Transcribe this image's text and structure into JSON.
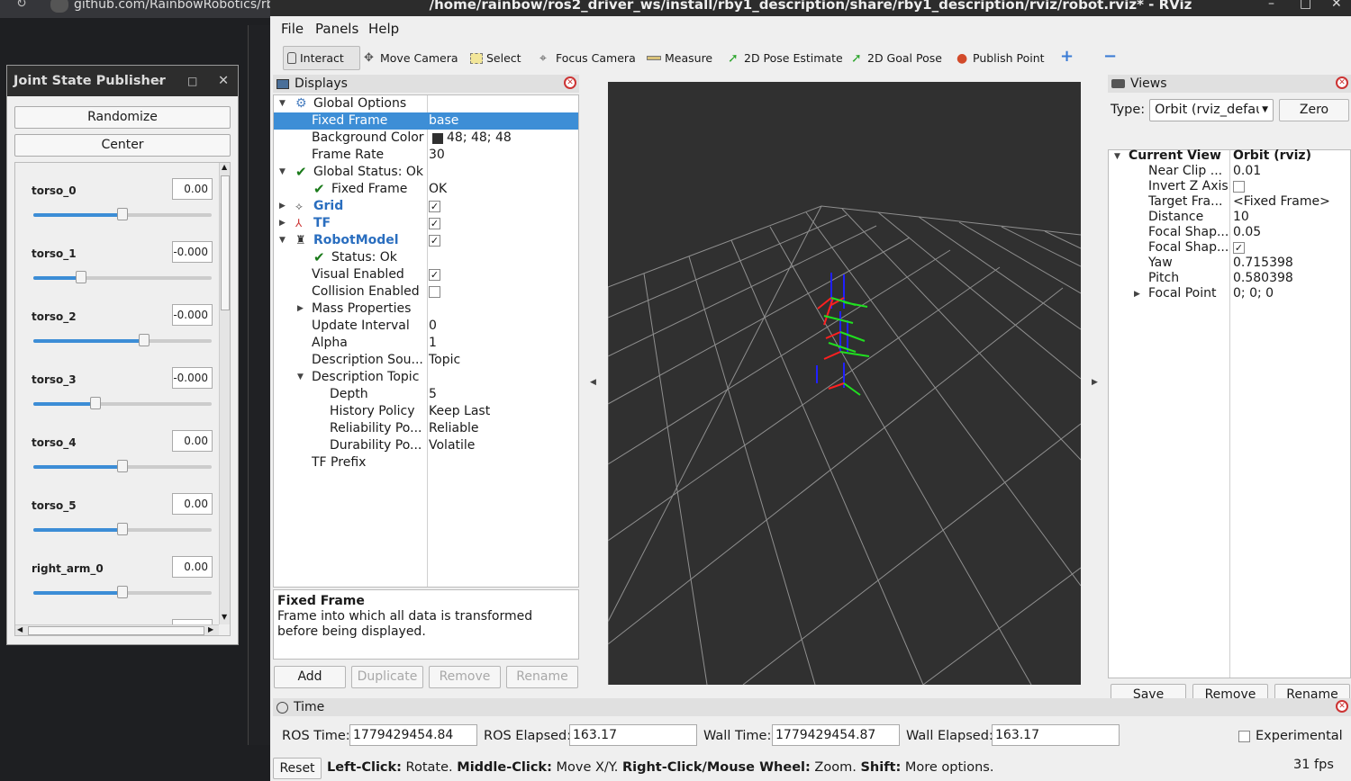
{
  "browser": {
    "url": "github.com/RainbowRobotics/rby"
  },
  "window": {
    "title": "/home/rainbow/ros2_driver_ws/install/rby1_description/share/rby1_description/rviz/robot.rviz* - RViz",
    "min": "–",
    "max": "□",
    "close": "✕"
  },
  "menu": [
    "File",
    "Panels",
    "Help"
  ],
  "toolbar": {
    "interact": "Interact",
    "move_camera": "Move Camera",
    "select": "Select",
    "focus_camera": "Focus Camera",
    "measure": "Measure",
    "pose_estimate": "2D Pose Estimate",
    "goal_pose": "2D Goal Pose",
    "publish_point": "Publish Point",
    "plus": "+",
    "minus": "−"
  },
  "displays": {
    "title": "Displays",
    "rows": {
      "global_options": "Global Options",
      "fixed_frame": {
        "label": "Fixed Frame",
        "value": "base"
      },
      "background_color": {
        "label": "Background Color",
        "value": "48; 48; 48"
      },
      "frame_rate": {
        "label": "Frame Rate",
        "value": "30"
      },
      "global_status": "Global Status: Ok",
      "gs_fixed_frame": {
        "label": "Fixed Frame",
        "value": "OK"
      },
      "grid": "Grid",
      "tf": "TF",
      "robot_model": "RobotModel",
      "status": "Status: Ok",
      "visual_enabled": "Visual Enabled",
      "collision_enabled": "Collision Enabled",
      "mass_properties": "Mass Properties",
      "update_interval": {
        "label": "Update Interval",
        "value": "0"
      },
      "alpha": {
        "label": "Alpha",
        "value": "1"
      },
      "description_source": {
        "label": "Description Sou...",
        "value": "Topic"
      },
      "description_topic": "Description Topic",
      "depth": {
        "label": "Depth",
        "value": "5"
      },
      "history_policy": {
        "label": "History Policy",
        "value": "Keep Last"
      },
      "reliability_policy": {
        "label": "Reliability Po...",
        "value": "Reliable"
      },
      "durability_policy": {
        "label": "Durability Po...",
        "value": "Volatile"
      },
      "tf_prefix": "TF Prefix"
    },
    "description_title": "Fixed Frame",
    "description_text": "Frame into which all data is transformed before being displayed.",
    "buttons": {
      "add": "Add",
      "duplicate": "Duplicate",
      "remove": "Remove",
      "rename": "Rename"
    }
  },
  "views": {
    "title": "Views",
    "type_label": "Type:",
    "type_value": "Orbit (rviz_defau",
    "zero": "Zero",
    "current_view": {
      "label": "Current View",
      "value": "Orbit (rviz)"
    },
    "props": [
      {
        "label": "Near Clip ...",
        "value": "0.01"
      },
      {
        "label": "Invert Z Axis",
        "value": ""
      },
      {
        "label": "Target Fra...",
        "value": "<Fixed Frame>"
      },
      {
        "label": "Distance",
        "value": "10"
      },
      {
        "label": "Focal Shap...",
        "value": "0.05"
      },
      {
        "label": "Focal Shap...",
        "value": ""
      },
      {
        "label": "Yaw",
        "value": "0.715398"
      },
      {
        "label": "Pitch",
        "value": "0.580398"
      },
      {
        "label": "Focal Point",
        "value": "0; 0; 0"
      }
    ],
    "buttons": {
      "save": "Save",
      "remove": "Remove",
      "rename": "Rename"
    }
  },
  "time": {
    "title": "Time",
    "ros_time_label": "ROS Time:",
    "ros_time": "1779429454.84",
    "ros_elapsed_label": "ROS Elapsed:",
    "ros_elapsed": "163.17",
    "wall_time_label": "Wall Time:",
    "wall_time": "1779429454.87",
    "wall_elapsed_label": "Wall Elapsed:",
    "wall_elapsed": "163.17",
    "experimental": "Experimental",
    "reset": "Reset",
    "hint_b1": "Left-Click:",
    "hint_t1": " Rotate. ",
    "hint_b2": "Middle-Click:",
    "hint_t2": " Move X/Y. ",
    "hint_b3": "Right-Click/Mouse Wheel:",
    "hint_t3": " Zoom. ",
    "hint_b4": "Shift:",
    "hint_t4": " More options.",
    "fps": "31 fps"
  },
  "jsp": {
    "title": "Joint State Publisher",
    "randomize": "Randomize",
    "center": "Center",
    "joints": [
      {
        "name": "torso_0",
        "value": "0.00",
        "pos": 0.5
      },
      {
        "name": "torso_1",
        "value": "-0.000",
        "pos": 0.27
      },
      {
        "name": "torso_2",
        "value": "-0.000",
        "pos": 0.62
      },
      {
        "name": "torso_3",
        "value": "-0.000",
        "pos": 0.35
      },
      {
        "name": "torso_4",
        "value": "0.00",
        "pos": 0.5
      },
      {
        "name": "torso_5",
        "value": "0.00",
        "pos": 0.5
      },
      {
        "name": "right_arm_0",
        "value": "0.00",
        "pos": 0.5
      }
    ]
  },
  "colors": {
    "selection": "#3d8ed6",
    "viewport_bg": "#303030",
    "grid": "#9a9a9a",
    "link_blue": "#2a6ebf"
  }
}
